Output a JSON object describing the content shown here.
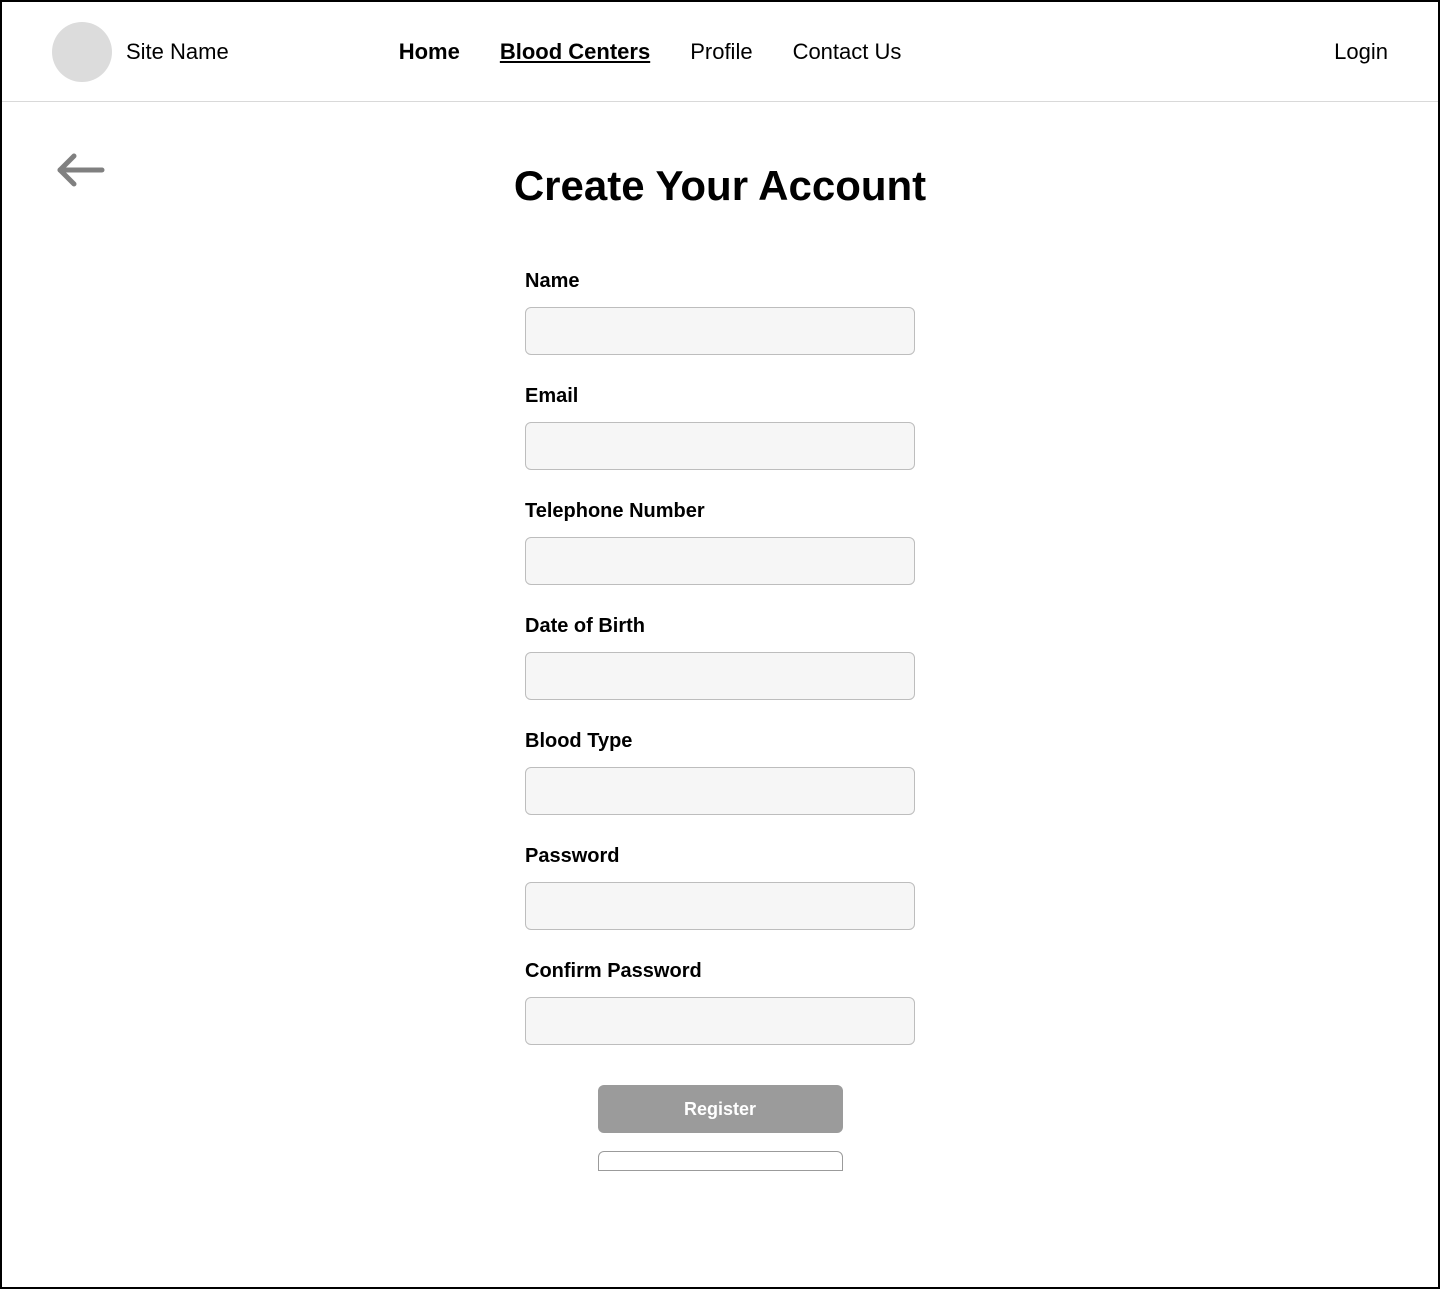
{
  "header": {
    "site_name": "Site Name",
    "nav": {
      "home": "Home",
      "blood_centers": "Blood Centers",
      "profile": "Profile",
      "contact_us": "Contact Us"
    },
    "login": "Login"
  },
  "page": {
    "title": "Create Your Account"
  },
  "form": {
    "name_label": "Name",
    "email_label": "Email",
    "telephone_label": "Telephone Number",
    "dob_label": "Date of Birth",
    "blood_type_label": "Blood Type",
    "password_label": "Password",
    "confirm_password_label": "Confirm Password",
    "name_value": "",
    "email_value": "",
    "telephone_value": "",
    "dob_value": "",
    "blood_type_value": "",
    "password_value": "",
    "confirm_password_value": "",
    "register_label": "Register"
  }
}
